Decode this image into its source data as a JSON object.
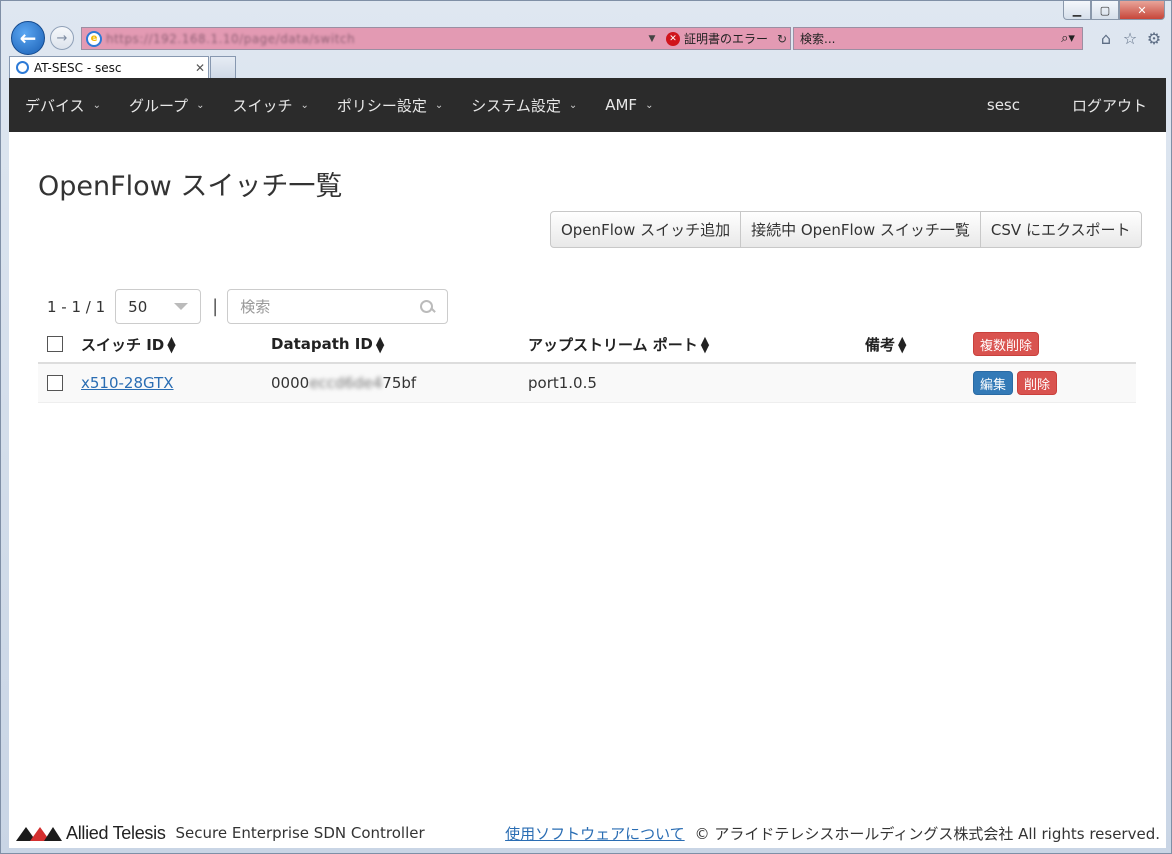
{
  "browser": {
    "address_url": "https://192.168.1.10/page/data/switch",
    "cert_error": "証明書のエラー",
    "search_placeholder": "検索...",
    "tab_title": "AT-SESC - sesc"
  },
  "nav": {
    "items": [
      "デバイス",
      "グループ",
      "スイッチ",
      "ポリシー設定",
      "システム設定",
      "AMF"
    ],
    "user": "sesc",
    "logout": "ログアウト"
  },
  "page": {
    "title": "OpenFlow スイッチ一覧",
    "buttons": {
      "add": "OpenFlow スイッチ追加",
      "connected": "接続中 OpenFlow スイッチ一覧",
      "export": "CSV にエクスポート"
    },
    "pager": {
      "count": "1 - 1 / 1",
      "page_size": "50",
      "search_placeholder": "検索"
    },
    "table": {
      "headers": {
        "switch_id": "スイッチ ID",
        "datapath_id": "Datapath ID",
        "upstream_port": "アップストリーム ポート",
        "note": "備考",
        "bulk_delete": "複数削除"
      },
      "rows": [
        {
          "switch_id": "x510-28GTX",
          "datapath_prefix": "0000",
          "datapath_hidden": "eccd6de4",
          "datapath_suffix": "75bf",
          "upstream_port": "port1.0.5",
          "note": "",
          "edit": "編集",
          "delete": "削除"
        }
      ]
    }
  },
  "footer": {
    "logo_text": "Allied Telesis",
    "product": "Secure Enterprise SDN Controller",
    "about": "使用ソフトウェアについて",
    "copyright": "© アライドテレシスホールディングス株式会社 All rights reserved."
  }
}
